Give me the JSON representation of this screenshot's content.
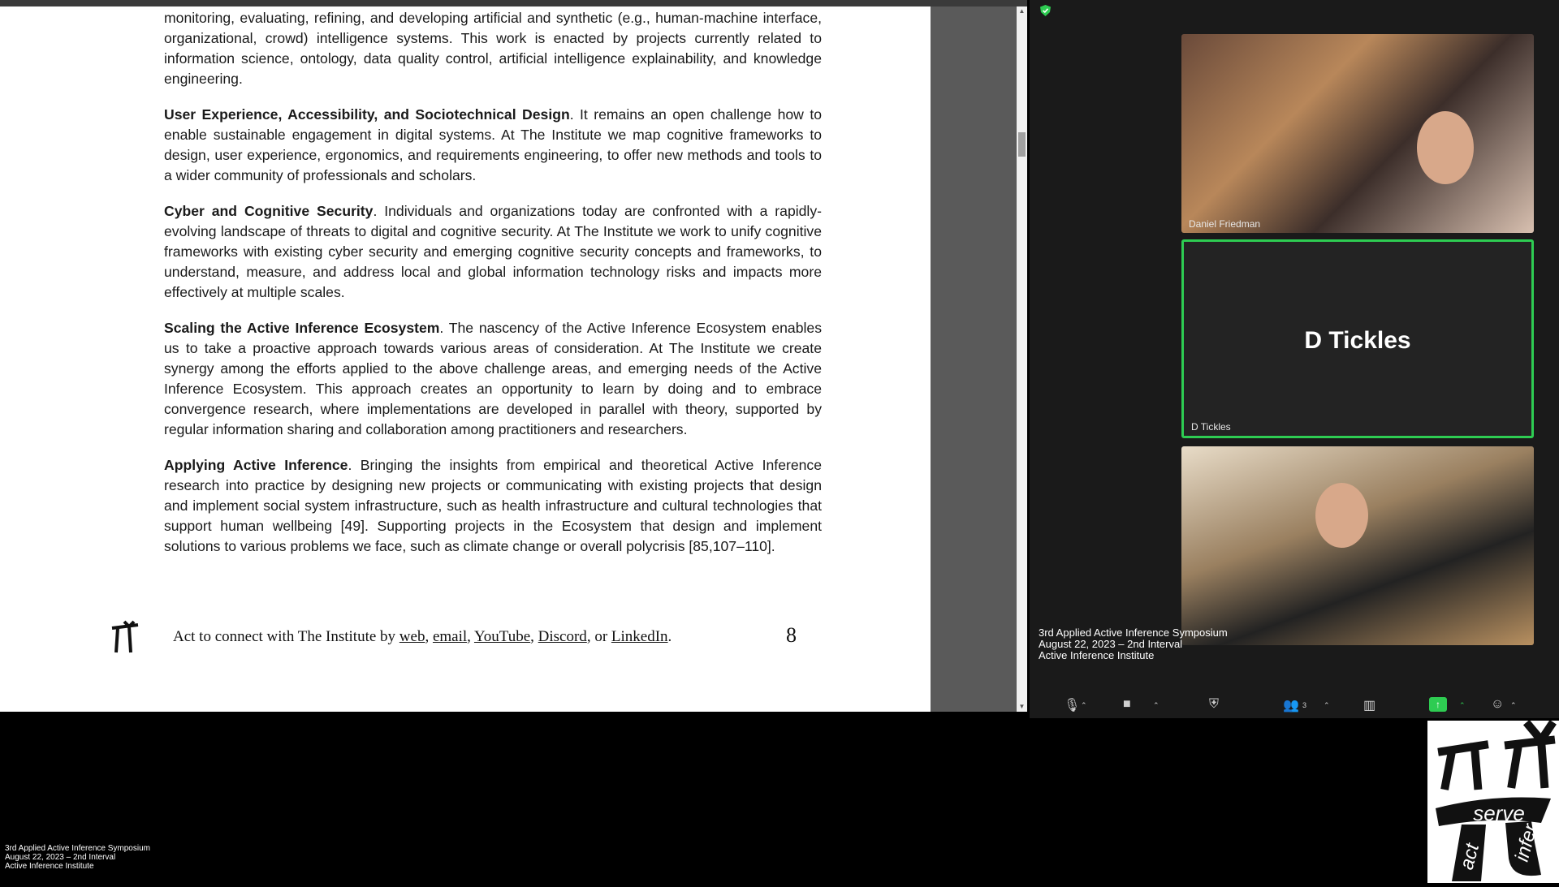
{
  "pdf": {
    "paragraphs": [
      {
        "heading": "",
        "text": "monitoring, evaluating, refining, and developing artificial and synthetic (e.g., human-machine interface, organizational, crowd) intelligence systems. This work is enacted by projects currently related to information science, ontology, data quality control, artificial intelligence explainability, and knowledge engineering."
      },
      {
        "heading": "User Experience, Accessibility, and Sociotechnical Design",
        "text": ". It remains an open challenge how to enable sustainable engagement in digital systems. At The Institute we map cognitive frameworks to design, user experience, ergonomics, and requirements engineering, to offer new methods and tools to a wider community of professionals and scholars."
      },
      {
        "heading": "Cyber and Cognitive Security",
        "text": ". Individuals and organizations today are confronted with a rapidly-evolving landscape of threats to digital and cognitive security. At The Institute we work to unify cognitive frameworks with existing cyber security and emerging cognitive security concepts and frameworks, to understand, measure, and address local and global information technology risks and impacts more effectively at multiple scales."
      },
      {
        "heading": "Scaling the Active Inference Ecosystem",
        "text": ". The nascency of the Active Inference Ecosystem enables us to take a proactive approach towards various areas of consideration. At The Institute we create synergy among the efforts applied to the above challenge areas, and emerging needs of the Active Inference Ecosystem. This approach creates an opportunity to learn by doing and to embrace convergence research, where implementations are developed in parallel with theory, supported by regular information sharing and collaboration among practitioners and researchers."
      },
      {
        "heading": "Applying Active Inference",
        "text": ". Bringing the insights from empirical and theoretical Active Inference research into practice by designing new projects or communicating with existing projects that design and implement social system infrastructure, such as health infrastructure and cultural technologies that support human wellbeing [49]. Supporting projects in the Ecosystem that design and implement solutions to various problems we face, such as climate change or overall polycrisis [85,107–110]."
      }
    ],
    "footer": {
      "prefix": "Act to connect with The Institute by ",
      "links": [
        "web",
        "email",
        "YouTube",
        "Discord",
        "LinkedIn"
      ],
      "sep1": ", ",
      "sep2": ", ",
      "sep3": ", ",
      "sep4": ", or ",
      "suffix": ".",
      "page_number": "8"
    }
  },
  "conference": {
    "participants": [
      {
        "name": "Daniel Friedman",
        "display": ""
      },
      {
        "name": "D Tickles",
        "display": "D Tickles"
      },
      {
        "name": "",
        "display": ""
      }
    ],
    "overlay": [
      "3rd Applied Active Inference Symposium",
      "August 22, 2023 – 2nd Interval",
      "Active Inference Institute"
    ],
    "toolbar_icons": [
      "microphone-icon",
      "camera-icon",
      "security-icon",
      "participants-icon",
      "polls-icon",
      "share-screen-icon",
      "reactions-icon"
    ],
    "participants_count": "3",
    "accent_color": "#2ecc52"
  },
  "bottom_caption": [
    "3rd Applied Active Inference Symposium",
    "August 22, 2023 – 2nd Interval",
    "Active Inference Institute"
  ],
  "logo": {
    "word_top": "serve",
    "word_left": "act",
    "word_right": "infer"
  }
}
